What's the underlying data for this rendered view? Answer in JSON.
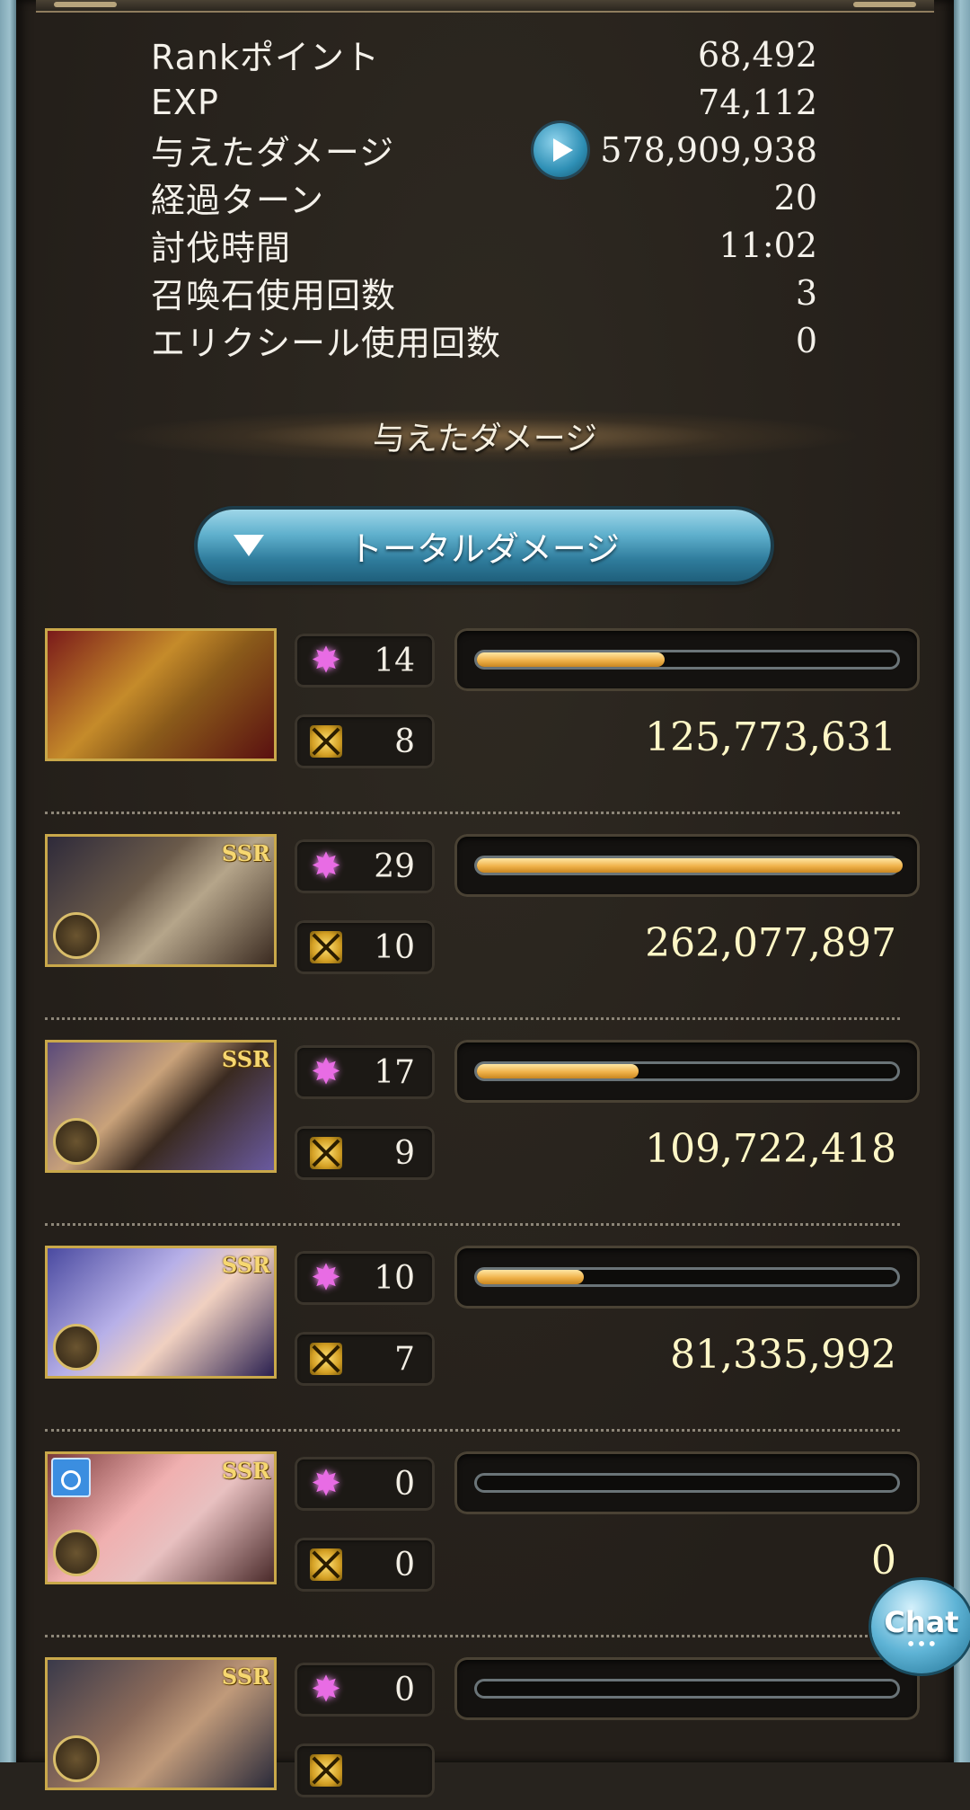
{
  "stats": [
    {
      "label": "Rankポイント",
      "value": "68,492"
    },
    {
      "label": "EXP",
      "value": "74,112"
    },
    {
      "label": "与えたダメージ",
      "value": "578,909,938",
      "has_play_icon": true
    },
    {
      "label": "経過ターン",
      "value": "20"
    },
    {
      "label": "討伐時間",
      "value": "11:02"
    },
    {
      "label": "召喚石使用回数",
      "value": "3"
    },
    {
      "label": "エリクシール使用回数",
      "value": "0"
    }
  ],
  "section_title": "与えたダメージ",
  "dropdown": {
    "selected": "トータルダメージ"
  },
  "characters": [
    {
      "ssr": "",
      "skill_count": "14",
      "attack_count": "8",
      "damage": "125,773,631",
      "bar_fraction": 0.44
    },
    {
      "ssr": "SSR",
      "skill_count": "29",
      "attack_count": "10",
      "damage": "262,077,897",
      "bar_fraction": 1.0
    },
    {
      "ssr": "SSR",
      "skill_count": "17",
      "attack_count": "9",
      "damage": "109,722,418",
      "bar_fraction": 0.38
    },
    {
      "ssr": "SSR",
      "skill_count": "10",
      "attack_count": "7",
      "damage": "81,335,992",
      "bar_fraction": 0.25
    },
    {
      "ssr": "SSR",
      "skill_count": "0",
      "attack_count": "0",
      "damage": "0",
      "bar_fraction": 0.0
    },
    {
      "ssr": "SSR",
      "skill_count": "0",
      "attack_count": "",
      "damage": "",
      "bar_fraction": 0.0
    }
  ],
  "chat": {
    "label": "Chat"
  },
  "colors": {
    "bar_fill": "#f0b24a",
    "damage_text": "#fff7c6",
    "accent_blue": "#2f7c9c"
  }
}
